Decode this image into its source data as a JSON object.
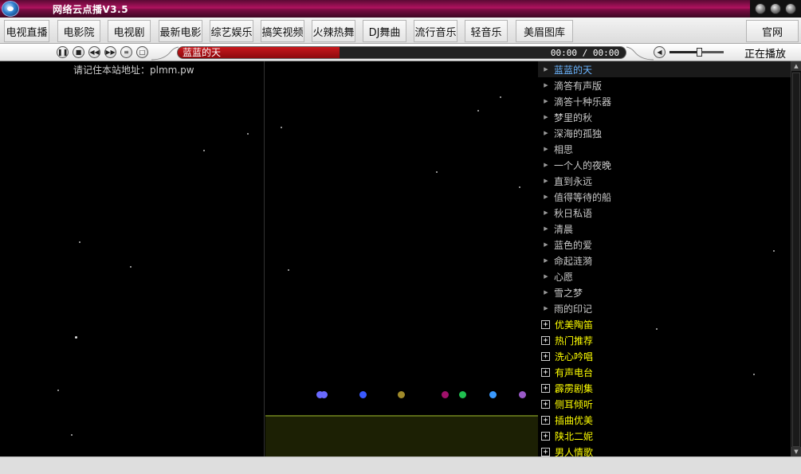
{
  "window": {
    "title": "网络云点播V3.5"
  },
  "menu": {
    "tabs": [
      {
        "label": "电视直播"
      },
      {
        "label": "电影院"
      },
      {
        "label": "电视剧"
      },
      {
        "label": "最新电影"
      },
      {
        "label": "综艺娱乐"
      },
      {
        "label": "搞笑视频"
      },
      {
        "label": "火辣热舞"
      },
      {
        "label": "DJ舞曲"
      },
      {
        "label": "流行音乐"
      },
      {
        "label": "轻音乐"
      },
      {
        "label": "美眉图库"
      }
    ],
    "official_label": "官网"
  },
  "player": {
    "pause_icon": "pause-icon",
    "stop_icon": "stop-icon",
    "prev_icon": "prev-icon",
    "next_icon": "next-icon",
    "now_playing": "蓝蓝的天",
    "time": "00:00 / 00:00",
    "progress": 0.36,
    "buffer": 0.36,
    "volume": 0.55,
    "status": "正在播放"
  },
  "notice": {
    "text": "请记住本站地址：plmm.pw"
  },
  "playlist": {
    "items": [
      {
        "label": "蓝蓝的天",
        "active": true
      },
      {
        "label": "滴答有声版"
      },
      {
        "label": "滴答十种乐器"
      },
      {
        "label": "梦里的秋"
      },
      {
        "label": "深海的孤独"
      },
      {
        "label": "相思"
      },
      {
        "label": "一个人的夜晚"
      },
      {
        "label": "直到永远"
      },
      {
        "label": "值得等待的船"
      },
      {
        "label": "秋日私语"
      },
      {
        "label": "清晨"
      },
      {
        "label": "蓝色的爱"
      },
      {
        "label": "命起涟漪"
      },
      {
        "label": "心愿"
      },
      {
        "label": "雪之梦"
      },
      {
        "label": "雨的印记"
      }
    ],
    "groups": [
      {
        "label": "优美陶笛"
      },
      {
        "label": "热门推荐"
      },
      {
        "label": "洗心吟唱"
      },
      {
        "label": "有声电台"
      },
      {
        "label": "霹雳剧集"
      },
      {
        "label": "侧耳倾听"
      },
      {
        "label": "插曲优美"
      },
      {
        "label": "陕北二妮"
      },
      {
        "label": "男人情歌"
      }
    ]
  },
  "colors": {
    "accent": "#b0125f",
    "active_item": "#6ab4ff",
    "group_text": "#ffff00",
    "viz_dots": [
      "#6a6aff",
      "#3a5aff",
      "#a08a2a",
      "#a0106a",
      "#20c050",
      "#3a9aff",
      "#9a5ac8"
    ]
  }
}
